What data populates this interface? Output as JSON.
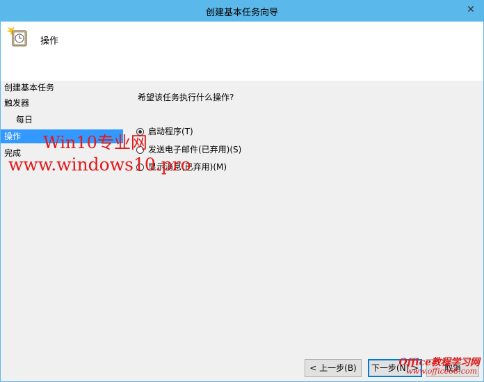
{
  "window": {
    "title": "创建基本任务向导",
    "close_label": "✕"
  },
  "header": {
    "icon": "clock-task-icon",
    "heading": "操作"
  },
  "sidebar": {
    "steps": [
      {
        "label": "创建基本任务"
      },
      {
        "label": "触发器"
      },
      {
        "label": "每日"
      },
      {
        "label": "操作"
      },
      {
        "label": "完成"
      }
    ]
  },
  "main": {
    "question": "希望该任务执行什么操作?",
    "options": [
      {
        "label": "启动程序(T)",
        "checked": true
      },
      {
        "label": "发送电子邮件(已弃用)(S)",
        "checked": false
      },
      {
        "label": "显示消息(已弃用)(M)",
        "checked": false
      }
    ]
  },
  "buttons": {
    "back": "< 上一步(B)",
    "next": "下一步(N) >",
    "cancel": "取消"
  },
  "watermarks": {
    "site_name": "Win10专业网",
    "site_url": "www.windows10.pro",
    "office_name": "Office教程学习网",
    "office_url": "www.office68.com"
  }
}
